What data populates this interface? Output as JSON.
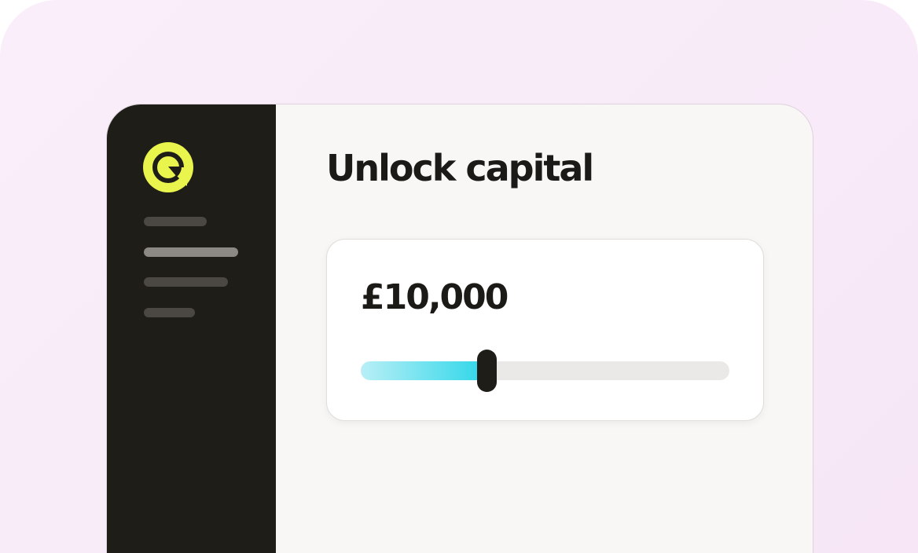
{
  "page": {
    "title": "Unlock capital"
  },
  "sidebar": {
    "logo_icon": "g-logo-icon",
    "logo_color": "#e9f44c"
  },
  "capital_card": {
    "amount": "£10,000",
    "slider_fraction": 0.32,
    "slider_fill_color": "#36d8ea"
  },
  "colors": {
    "sidebar_bg": "#1f1d18",
    "content_bg": "#f8f7f5",
    "backdrop": "#f8ebf8"
  }
}
